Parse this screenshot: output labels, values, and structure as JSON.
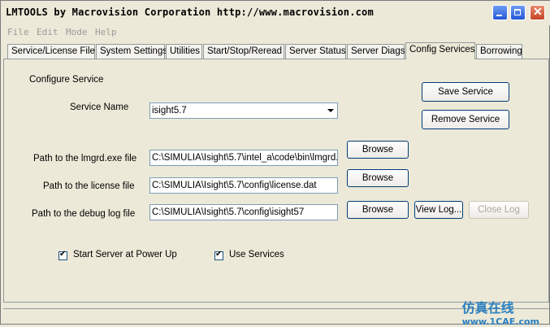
{
  "window": {
    "title": "LMTOOLS by Macrovision Corporation http://www.macrovision.com"
  },
  "menu": [
    "File",
    "Edit",
    "Mode",
    "Help"
  ],
  "tabs": [
    {
      "label": "Service/License File"
    },
    {
      "label": "System Settings"
    },
    {
      "label": "Utilities"
    },
    {
      "label": "Start/Stop/Reread"
    },
    {
      "label": "Server Status"
    },
    {
      "label": "Server Diags"
    },
    {
      "label": "Config Services",
      "active": true
    },
    {
      "label": "Borrowing"
    }
  ],
  "panel": {
    "heading": "Configure Service",
    "service_name_label": "Service Name",
    "service_name_value": "isight5.7",
    "lmgrd_label": "Path to the lmgrd.exe file",
    "lmgrd_value": "C:\\SIMULIA\\Isight\\5.7\\intel_a\\code\\bin\\lmgrd.e",
    "license_label": "Path to the license file",
    "license_value": "C:\\SIMULIA\\Isight\\5.7\\config\\license.dat",
    "debug_label": "Path to the debug log file",
    "debug_value": "C:\\SIMULIA\\Isight\\5.7\\config\\isight57",
    "save_service": "Save Service",
    "remove_service": "Remove Service",
    "browse": "Browse",
    "view_log": "View Log...",
    "close_log": "Close Log",
    "start_at_powerup": "Start Server at Power Up",
    "use_services": "Use Services"
  },
  "watermark": {
    "line1": "仿真在线",
    "line2": "www.1CAE.com"
  }
}
